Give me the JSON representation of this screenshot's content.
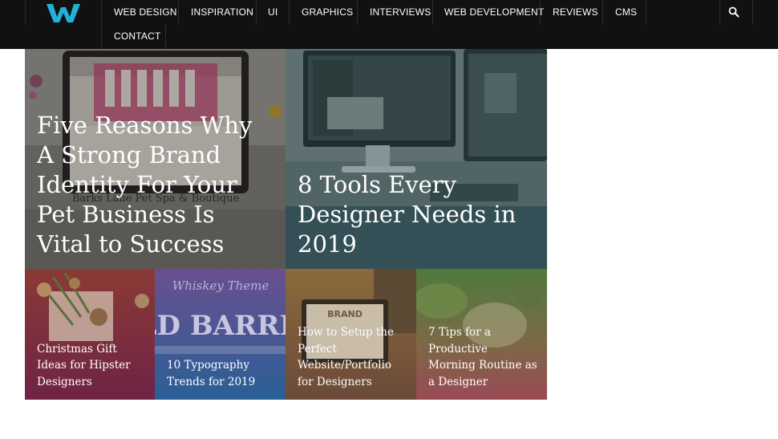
{
  "nav": {
    "logo_letter": "W",
    "items": [
      "WEB DESIGN",
      "INSPIRATION",
      "UI",
      "GRAPHICS",
      "INTERVIEWS",
      "WEB DEVELOPMENT",
      "REVIEWS",
      "CMS",
      "CONTACT"
    ],
    "search_icon": "search-icon"
  },
  "featured": [
    {
      "title": "Five Reasons Why A Strong Brand Identity For Your Pet Business Is Vital to Success"
    },
    {
      "title": "8 Tools Every Designer Needs in 2019"
    }
  ],
  "cards": [
    {
      "title": "Christmas Gift Ideas for Hipster Designers"
    },
    {
      "title": "10 Typography Trends for 2019"
    },
    {
      "title": "How to Setup the Perfect Website/Portfolio for Designers"
    },
    {
      "title": "7 Tips for a Productive Morning Routine as a Designer"
    }
  ],
  "photo_text": {
    "pet_sign": "Barks Lane Pet Spa & Boutique",
    "whiskey": "Whiskey Theme",
    "barrel": "LD BARRE",
    "brand": "BRAND"
  },
  "colors": {
    "nav_bg": "#111111",
    "logo": "#1fb3d9"
  }
}
